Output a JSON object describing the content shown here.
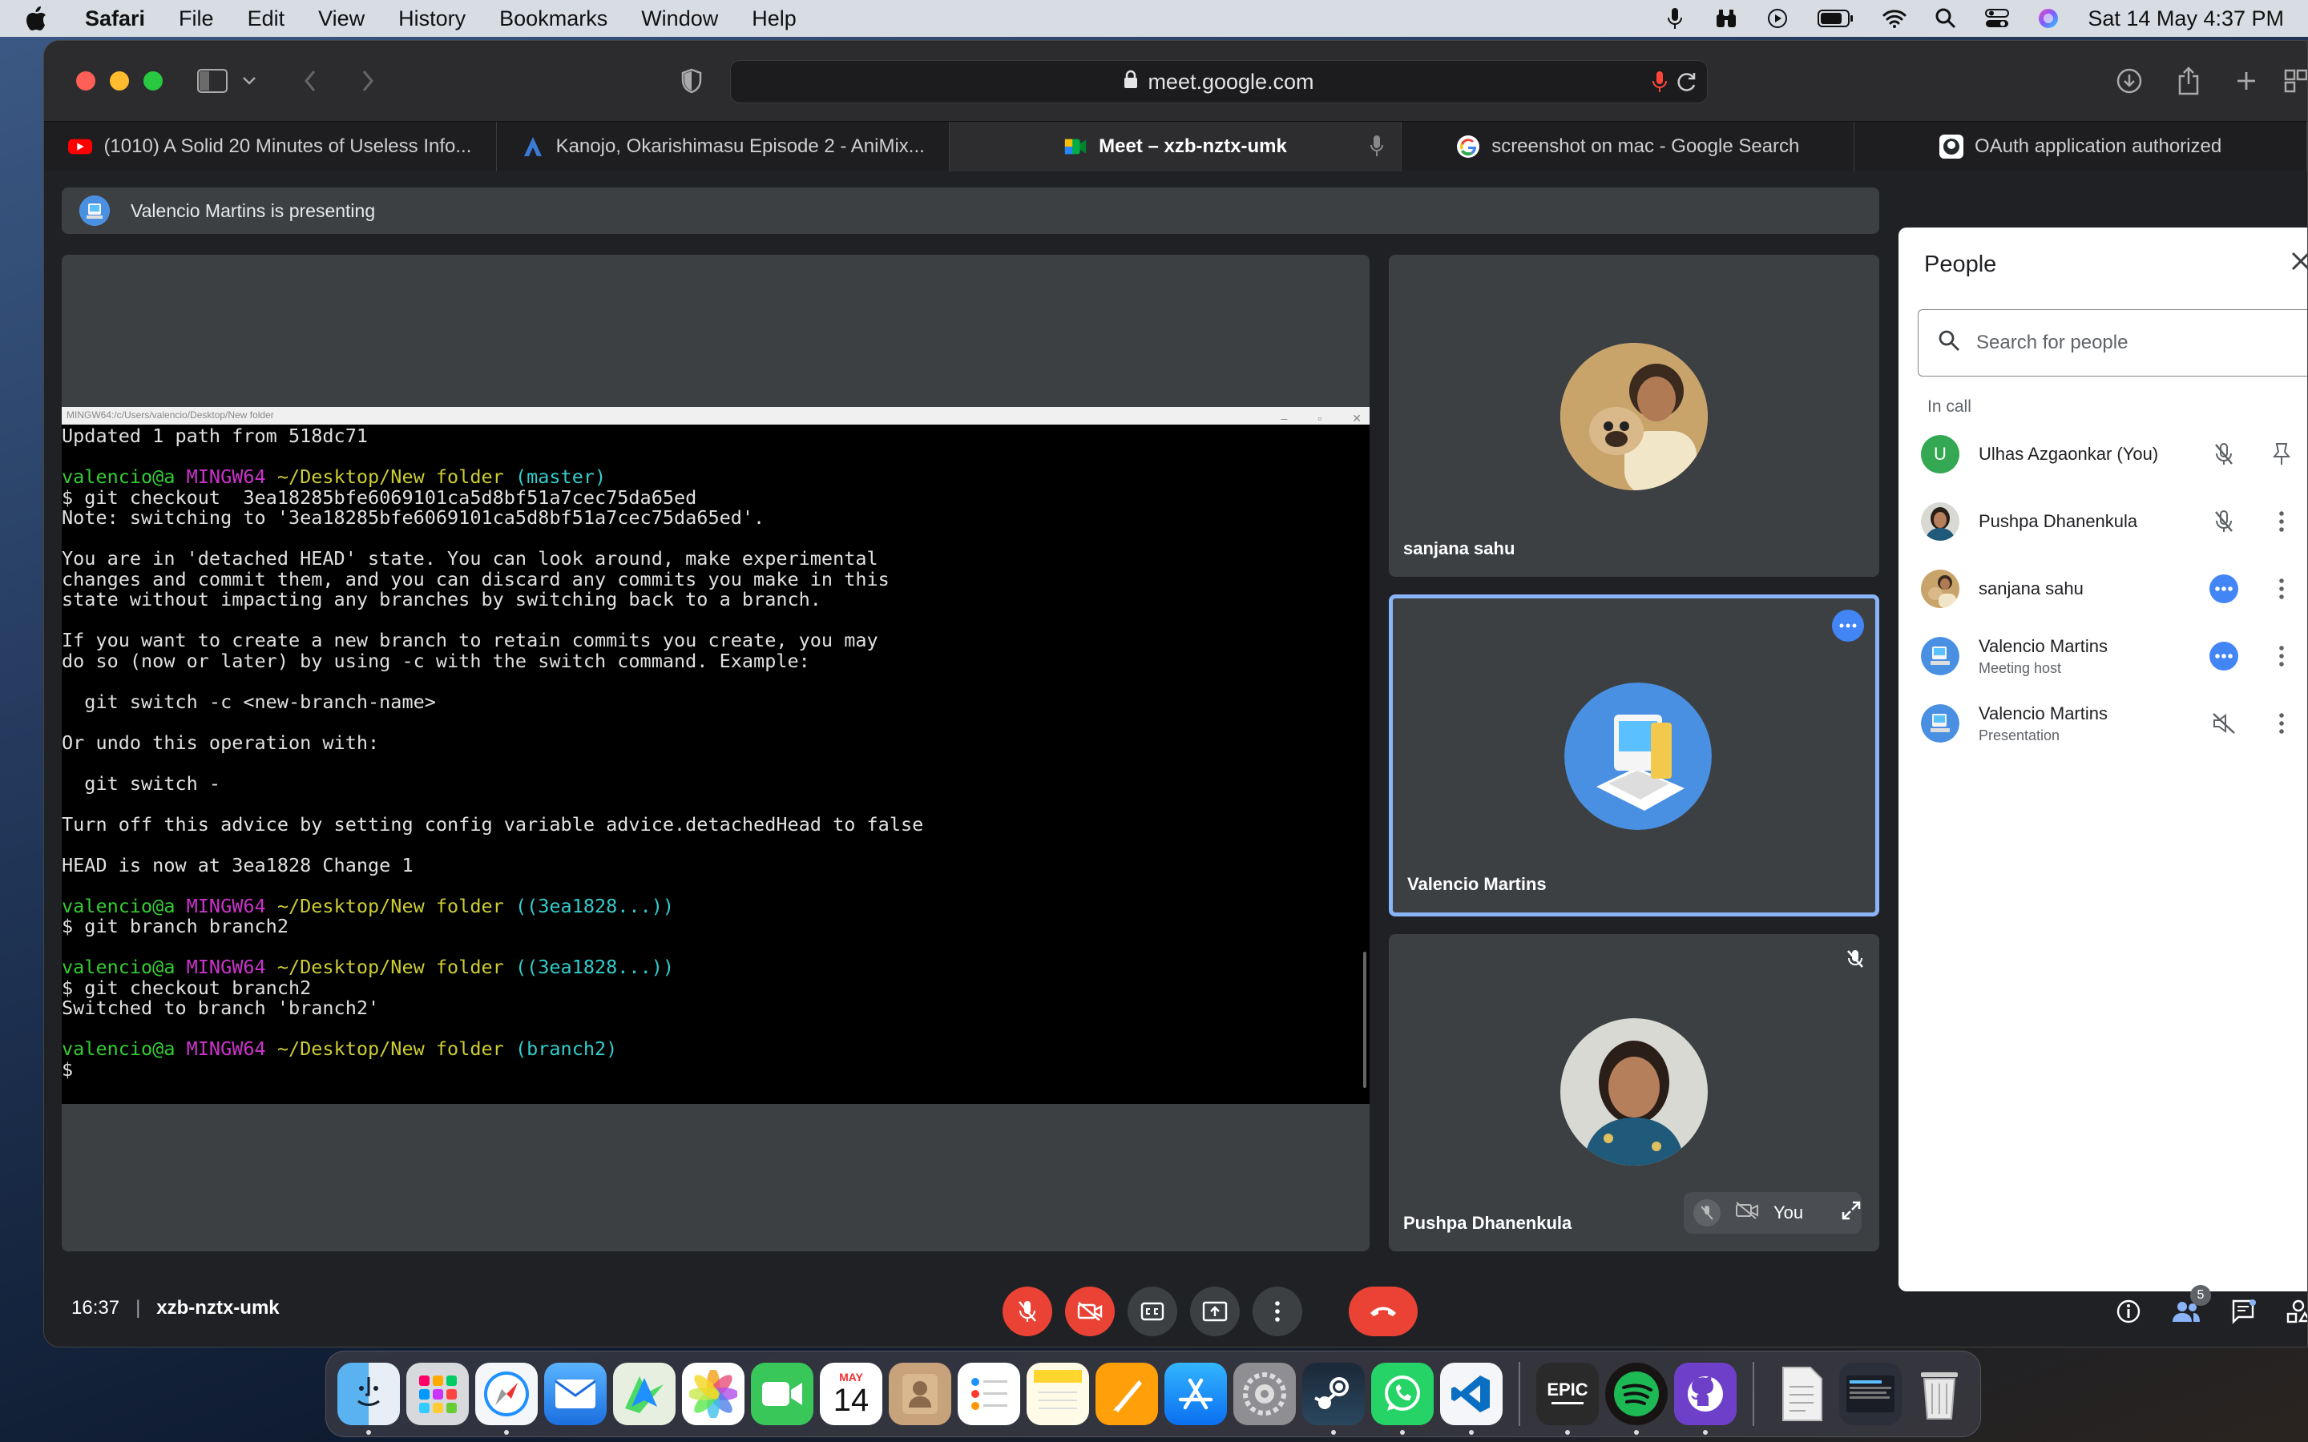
{
  "menubar": {
    "app": "Safari",
    "items": [
      "File",
      "Edit",
      "View",
      "History",
      "Bookmarks",
      "Window",
      "Help"
    ],
    "clock": "Sat 14 May  4:37 PM"
  },
  "browser": {
    "url": "meet.google.com",
    "tabs": [
      {
        "label": "(1010) A Solid 20 Minutes of Useless Info...",
        "icon": "youtube-icon"
      },
      {
        "label": "Kanojo, Okarishimasu Episode 2 - AniMix...",
        "icon": "animix-icon"
      },
      {
        "label": "Meet – xzb-nztx-umk",
        "icon": "google-meet-icon"
      },
      {
        "label": "screenshot on mac - Google Search",
        "icon": "google-icon"
      },
      {
        "label": "OAuth application authorized",
        "icon": "github-icon"
      }
    ]
  },
  "meet": {
    "presenting_text": "Valencio Martins is presenting",
    "terminal_title": "MINGW64:/c/Users/valencio/Desktop/New folder",
    "terminal_lines": [
      [
        {
          "t": "Updated 1 path from 518dc71",
          "c": ""
        }
      ],
      [
        {
          "t": "",
          "c": ""
        }
      ],
      [
        {
          "t": "valencio@a ",
          "c": "c-green"
        },
        {
          "t": "MINGW64 ",
          "c": "c-mag"
        },
        {
          "t": "~/Desktop/New folder ",
          "c": "c-yel"
        },
        {
          "t": "(master)",
          "c": "c-cyan"
        }
      ],
      [
        {
          "t": "$ git checkout  3ea18285bfe6069101ca5d8bf51a7cec75da65ed",
          "c": ""
        }
      ],
      [
        {
          "t": "Note: switching to '3ea18285bfe6069101ca5d8bf51a7cec75da65ed'.",
          "c": ""
        }
      ],
      [
        {
          "t": "",
          "c": ""
        }
      ],
      [
        {
          "t": "You are in 'detached HEAD' state. You can look around, make experimental",
          "c": ""
        }
      ],
      [
        {
          "t": "changes and commit them, and you can discard any commits you make in this",
          "c": ""
        }
      ],
      [
        {
          "t": "state without impacting any branches by switching back to a branch.",
          "c": ""
        }
      ],
      [
        {
          "t": "",
          "c": ""
        }
      ],
      [
        {
          "t": "If you want to create a new branch to retain commits you create, you may",
          "c": ""
        }
      ],
      [
        {
          "t": "do so (now or later) by using -c with the switch command. Example:",
          "c": ""
        }
      ],
      [
        {
          "t": "",
          "c": ""
        }
      ],
      [
        {
          "t": "  git switch -c <new-branch-name>",
          "c": ""
        }
      ],
      [
        {
          "t": "",
          "c": ""
        }
      ],
      [
        {
          "t": "Or undo this operation with:",
          "c": ""
        }
      ],
      [
        {
          "t": "",
          "c": ""
        }
      ],
      [
        {
          "t": "  git switch -",
          "c": ""
        }
      ],
      [
        {
          "t": "",
          "c": ""
        }
      ],
      [
        {
          "t": "Turn off this advice by setting config variable advice.detachedHead to false",
          "c": ""
        }
      ],
      [
        {
          "t": "",
          "c": ""
        }
      ],
      [
        {
          "t": "HEAD is now at 3ea1828 Change 1",
          "c": ""
        }
      ],
      [
        {
          "t": "",
          "c": ""
        }
      ],
      [
        {
          "t": "valencio@a ",
          "c": "c-green"
        },
        {
          "t": "MINGW64 ",
          "c": "c-mag"
        },
        {
          "t": "~/Desktop/New folder ",
          "c": "c-yel"
        },
        {
          "t": "((3ea1828...))",
          "c": "c-cyan"
        }
      ],
      [
        {
          "t": "$ git branch branch2",
          "c": ""
        }
      ],
      [
        {
          "t": "",
          "c": ""
        }
      ],
      [
        {
          "t": "valencio@a ",
          "c": "c-green"
        },
        {
          "t": "MINGW64 ",
          "c": "c-mag"
        },
        {
          "t": "~/Desktop/New folder ",
          "c": "c-yel"
        },
        {
          "t": "((3ea1828...))",
          "c": "c-cyan"
        }
      ],
      [
        {
          "t": "$ git checkout branch2",
          "c": ""
        }
      ],
      [
        {
          "t": "Switched to branch 'branch2'",
          "c": ""
        }
      ],
      [
        {
          "t": "",
          "c": ""
        }
      ],
      [
        {
          "t": "valencio@a ",
          "c": "c-green"
        },
        {
          "t": "MINGW64 ",
          "c": "c-mag"
        },
        {
          "t": "~/Desktop/New folder ",
          "c": "c-yel"
        },
        {
          "t": "(branch2)",
          "c": "c-cyan"
        }
      ],
      [
        {
          "t": "$ ",
          "c": ""
        }
      ]
    ],
    "tiles": [
      {
        "name": "sanjana sahu"
      },
      {
        "name": "Valencio Martins"
      },
      {
        "name": "Pushpa Dhanenkula",
        "self_label": "You"
      }
    ],
    "time": "16:37",
    "meeting_code": "xzb-nztx-umk",
    "people_count": "5"
  },
  "people_panel": {
    "title": "People",
    "search_placeholder": "Search for people",
    "section": "In call",
    "participants": [
      {
        "name": "Ulhas Azgaonkar (You)",
        "sub": "",
        "initial": "U",
        "color": "#34a853"
      },
      {
        "name": "Pushpa Dhanenkula",
        "sub": ""
      },
      {
        "name": "sanjana sahu",
        "sub": ""
      },
      {
        "name": "Valencio Martins",
        "sub": "Meeting host"
      },
      {
        "name": "Valencio Martins",
        "sub": "Presentation"
      }
    ]
  },
  "dock": {
    "apps": [
      "finder-icon",
      "launchpad-icon",
      "safari-icon",
      "mail-icon",
      "maps-icon",
      "photos-icon",
      "facetime-icon",
      "calendar-icon",
      "contacts-icon",
      "reminders-icon",
      "notes-icon",
      "pages-icon",
      "app-store-icon",
      "system-preferences-icon",
      "steam-icon",
      "whatsapp-icon",
      "vscode-icon",
      "epic-games-icon",
      "spotify-icon",
      "github-desktop-icon",
      "document-icon",
      "screenshot-icon",
      "trash-icon"
    ],
    "calendar_month": "MAY",
    "calendar_day": "14",
    "epic_label": "EPIC"
  },
  "colors": {
    "accent": "#8ab4f8",
    "danger": "#ea4335",
    "meet_bg": "#202124",
    "tile_bg": "#3c4043"
  }
}
